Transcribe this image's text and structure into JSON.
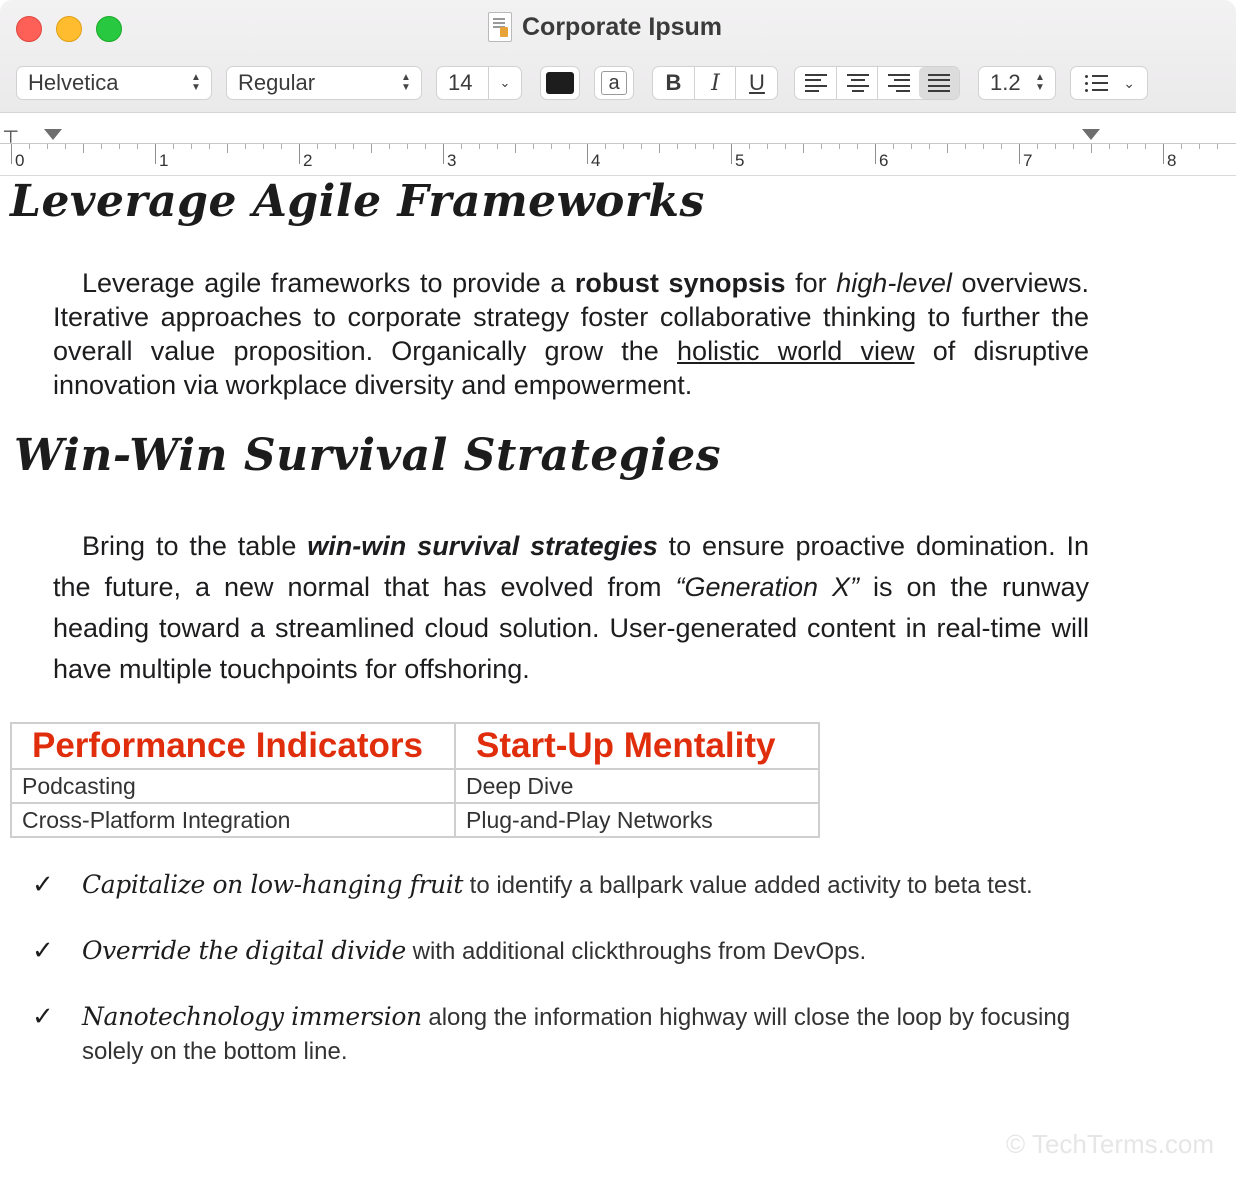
{
  "window": {
    "title": "Corporate Ipsum"
  },
  "toolbar": {
    "font_family": "Helvetica",
    "font_style": "Regular",
    "font_size": "14",
    "text_color": "#1d1d1d",
    "background_color_label": "a",
    "bold": "B",
    "italic": "I",
    "underline": "U",
    "alignment_options": [
      "left",
      "center",
      "right",
      "justify"
    ],
    "alignment_selected": "justify",
    "line_spacing": "1.2",
    "list_style_icon": "bulleted-list-icon"
  },
  "ruler": {
    "numbers": [
      "0",
      "1",
      "2",
      "3",
      "4",
      "5",
      "6",
      "7",
      "8"
    ]
  },
  "doc": {
    "heading1": "Leverage Agile Frameworks",
    "p1": {
      "a": "Leverage agile frameworks to provide a ",
      "b": "robust synopsis",
      "c": " for ",
      "d": "high-level",
      "e": " overviews. Iterative approaches to corporate strategy foster collaborative thinking to further the overall value proposition. Organically grow the ",
      "f": "holistic world view",
      "g": " of disruptive innovation via workplace diversity and empowerment."
    },
    "heading2": "Win-Win Survival Strategies",
    "p2": {
      "a": "Bring to the table ",
      "b": "win-win survival strategies",
      "c": " to ensure proactive domination. In the future, a new normal that has evolved from ",
      "d": "“Generation X”",
      "e": " is on the runway heading toward a streamlined cloud solution. User-generated content in real-time will have multiple touchpoints for offshoring."
    },
    "table": {
      "headers": [
        "Performance Indicators",
        "Start-Up Mentality"
      ],
      "rows": [
        [
          "Podcasting",
          "Deep Dive"
        ],
        [
          "Cross-Platform Integration",
          "Plug-and-Play Networks"
        ]
      ],
      "header_color": "#e02d0c"
    },
    "list": [
      {
        "check": "✓",
        "em": "Capitalize on low-hanging fruit",
        "rest": " to identify a ballpark value added activity to beta test."
      },
      {
        "check": "✓",
        "em": "Override the digital divide",
        "rest": " with additional clickthroughs from DevOps."
      },
      {
        "check": "✓",
        "em": "Nanotechnology immersion",
        "rest": " along the information highway will close the loop by focusing solely on the bottom line."
      }
    ]
  },
  "watermark": "© TechTerms.com"
}
